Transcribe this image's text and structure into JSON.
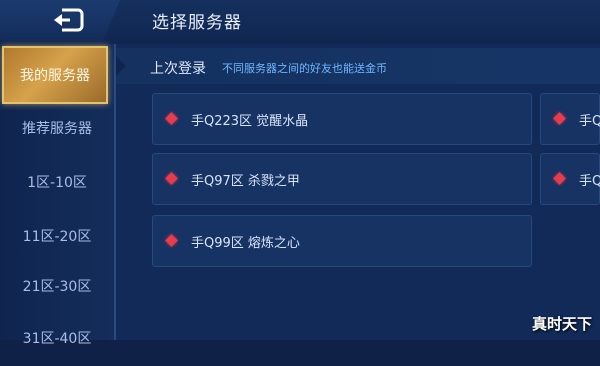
{
  "header": {
    "title": "选择服务器"
  },
  "sidebar": {
    "items": [
      {
        "label": "我的服务器",
        "active": true
      },
      {
        "label": "推荐服务器"
      },
      {
        "label": "1区-10区"
      },
      {
        "label": "11区-20区"
      },
      {
        "label": "21区-30区"
      },
      {
        "label": "31区-40区"
      }
    ]
  },
  "last_login": {
    "label": "上次登录",
    "note": "不同服务器之间的好友也能送金币"
  },
  "servers": [
    {
      "name": "手Q223区 觉醒水晶"
    },
    {
      "name": "手Q97区 杀戮之甲"
    },
    {
      "name": "手Q99区 熔炼之心"
    },
    {
      "name": "手Q"
    },
    {
      "name": "手Q"
    }
  ],
  "watermark": "真时天下",
  "colors": {
    "accent_gold": "#d6a24b",
    "status_red": "#e83b4b",
    "note_blue": "#6fb7ff"
  }
}
